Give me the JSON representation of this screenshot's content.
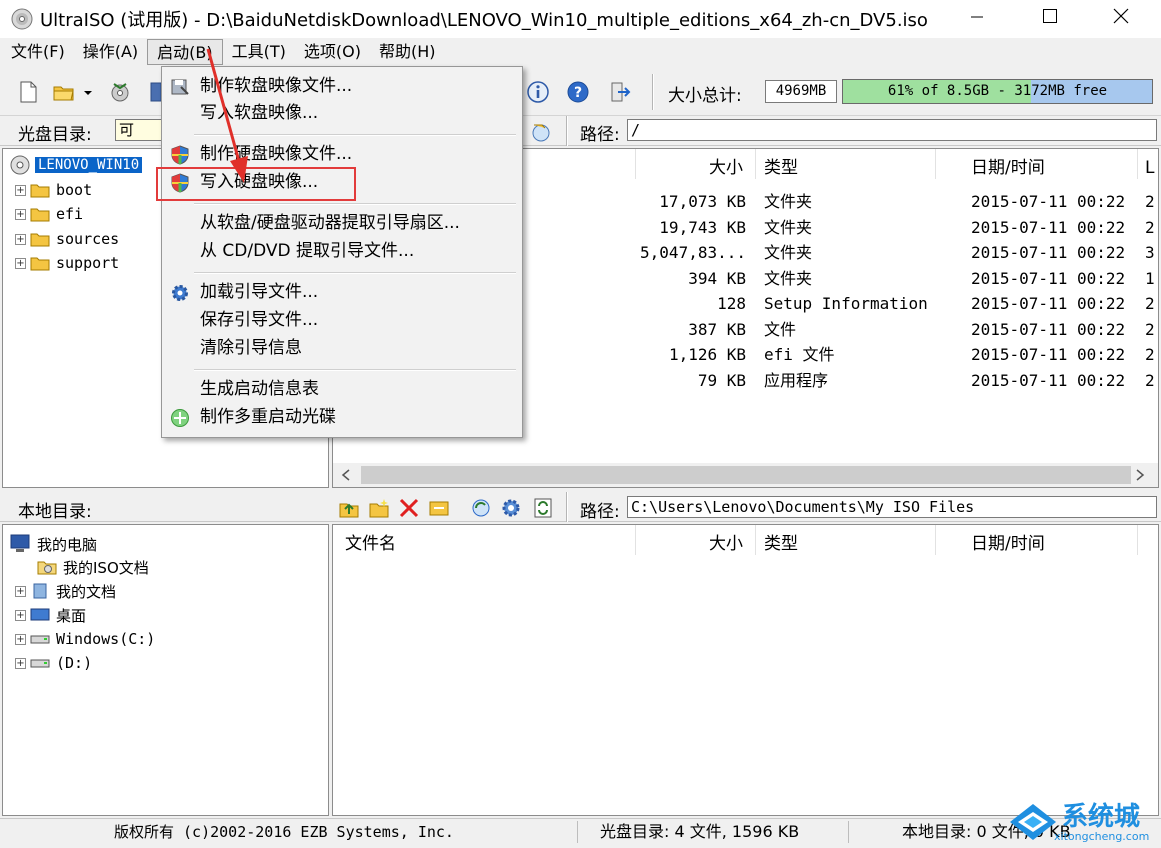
{
  "window": {
    "title": "UltraISO (试用版) - D:\\BaiduNetdiskDownload\\LENOVO_Win10_multiple_editions_x64_zh-cn_DV5.iso"
  },
  "menubar": {
    "items": [
      "文件(F)",
      "操作(A)",
      "启动(B)",
      "工具(T)",
      "选项(O)",
      "帮助(H)"
    ],
    "active": "启动(B)"
  },
  "toolbar": {
    "size_total_label": "大小总计:",
    "size_total_value": "4969MB",
    "capacity_text": "61% of 8.5GB - 3172MB free",
    "capacity_fill": 0.61
  },
  "iso_pane": {
    "dir_label": "光盘目录:",
    "dir_value": "可",
    "path_label": "路径:",
    "path_value": "/",
    "root": "LENOVO_WIN10",
    "tree": [
      "boot",
      "efi",
      "sources",
      "support"
    ],
    "columns": [
      "大小",
      "类型",
      "日期/时间",
      "L"
    ],
    "files": [
      {
        "size": "17,073 KB",
        "type": "文件夹",
        "date": "2015-07-11 00:22",
        "l": "2"
      },
      {
        "size": "19,743 KB",
        "type": "文件夹",
        "date": "2015-07-11 00:22",
        "l": "2"
      },
      {
        "size": "5,047,83...",
        "type": "文件夹",
        "date": "2015-07-11 00:22",
        "l": "3"
      },
      {
        "size": "394 KB",
        "type": "文件夹",
        "date": "2015-07-11 00:22",
        "l": "1"
      },
      {
        "size": "128",
        "type": "Setup Information",
        "date": "2015-07-11 00:22",
        "l": "2"
      },
      {
        "size": "387 KB",
        "type": "文件",
        "date": "2015-07-11 00:22",
        "l": "2"
      },
      {
        "size": "1,126 KB",
        "type": "efi 文件",
        "date": "2015-07-11 00:22",
        "l": "2"
      },
      {
        "size": "79 KB",
        "type": "应用程序",
        "date": "2015-07-11 00:22",
        "l": "2"
      }
    ]
  },
  "local_pane": {
    "dir_label": "本地目录:",
    "path_label": "路径:",
    "path_value": "C:\\Users\\Lenovo\\Documents\\My ISO Files",
    "tree": {
      "computer": "我的电脑",
      "iso_docs": "我的ISO文档",
      "my_docs": "我的文档",
      "desktop": "桌面",
      "drive_c": "Windows(C:)",
      "drive_d": "(D:)"
    },
    "columns": [
      "文件名",
      "大小",
      "类型",
      "日期/时间"
    ]
  },
  "dropdown": {
    "groups": [
      [
        "制作软盘映像文件...",
        "写入软盘映像..."
      ],
      [
        "制作硬盘映像文件...",
        "写入硬盘映像..."
      ],
      [
        "从软盘/硬盘驱动器提取引导扇区...",
        "从 CD/DVD 提取引导文件..."
      ],
      [
        "加载引导文件...",
        "保存引导文件...",
        "清除引导信息"
      ],
      [
        "生成启动信息表",
        "制作多重启动光碟"
      ]
    ],
    "highlighted": "写入硬盘映像..."
  },
  "statusbar": {
    "copyright": "版权所有 (c)2002-2016 EZB Systems, Inc.",
    "iso_info": "光盘目录: 4 文件, 1596 KB",
    "local_info": "本地目录: 0 文件, 0 KB"
  },
  "watermark": {
    "brand": "系统城",
    "url": "xitongcheng.com"
  },
  "colors": {
    "highlight_box": "#e23b3b",
    "arrow": "#e0302a",
    "capacity_fill": "#9fe09f",
    "capacity_bar": "#a7c8ee",
    "selection": "#0a64c8"
  }
}
